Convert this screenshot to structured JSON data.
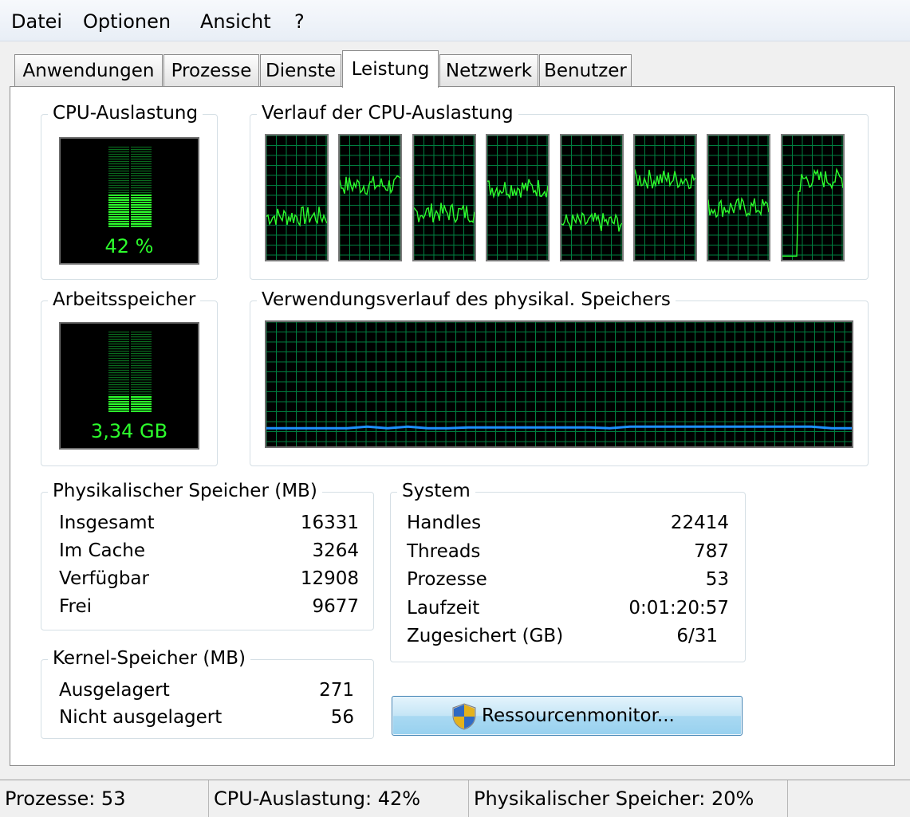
{
  "menu": [
    "Datei",
    "Optionen",
    "Ansicht",
    "?"
  ],
  "tabs": [
    "Anwendungen",
    "Prozesse",
    "Dienste",
    "Leistung",
    "Netzwerk",
    "Benutzer"
  ],
  "active_tab": "Leistung",
  "cpu": {
    "title": "CPU-Auslastung",
    "value_label": "42 %",
    "level": 0.42,
    "history_title": "Verlauf der CPU-Auslastung",
    "core_levels": [
      0.35,
      0.6,
      0.38,
      0.58,
      0.3,
      0.65,
      0.42,
      0.65
    ]
  },
  "memory": {
    "title": "Arbeitsspeicher",
    "value_label": "3,34 GB",
    "level": 0.2,
    "history_title": "Verwendungsverlauf des physikal. Speichers",
    "history_levels": [
      0.18,
      0.18,
      0.18,
      0.18,
      0.18,
      0.2,
      0.18,
      0.2,
      0.18,
      0.18,
      0.19,
      0.19,
      0.19,
      0.19,
      0.19,
      0.19,
      0.19,
      0.18,
      0.2,
      0.2,
      0.2,
      0.2,
      0.2,
      0.2,
      0.2,
      0.2,
      0.2,
      0.2,
      0.18,
      0.18
    ]
  },
  "physical_memory": {
    "title": "Physikalischer Speicher (MB)",
    "rows": [
      {
        "label": "Insgesamt",
        "value": "16331"
      },
      {
        "label": "Im Cache",
        "value": "3264"
      },
      {
        "label": "Verfügbar",
        "value": "12908"
      },
      {
        "label": "Frei",
        "value": "9677"
      }
    ]
  },
  "kernel_memory": {
    "title": "Kernel-Speicher (MB)",
    "rows": [
      {
        "label": "Ausgelagert",
        "value": "271"
      },
      {
        "label": "Nicht ausgelagert",
        "value": "56"
      }
    ]
  },
  "system": {
    "title": "System",
    "rows": [
      {
        "label": "Handles",
        "value": "22414"
      },
      {
        "label": "Threads",
        "value": "787"
      },
      {
        "label": "Prozesse",
        "value": "53"
      },
      {
        "label": "Laufzeit",
        "value": "0:01:20:57"
      },
      {
        "label": "Zugesichert (GB)",
        "value": "6/31"
      }
    ]
  },
  "resource_button": "Ressourcenmonitor...",
  "statusbar": {
    "processes": "Prozesse: 53",
    "cpu": "CPU-Auslastung: 42%",
    "memory": "Physikalischer Speicher: 20%"
  },
  "colors": {
    "graph_line": "#2dff2d",
    "grid": "#008040",
    "memory_line": "#1e90ff",
    "panel_bg": "#000000"
  },
  "icons": {
    "resource_button": "uac-shield-icon"
  }
}
